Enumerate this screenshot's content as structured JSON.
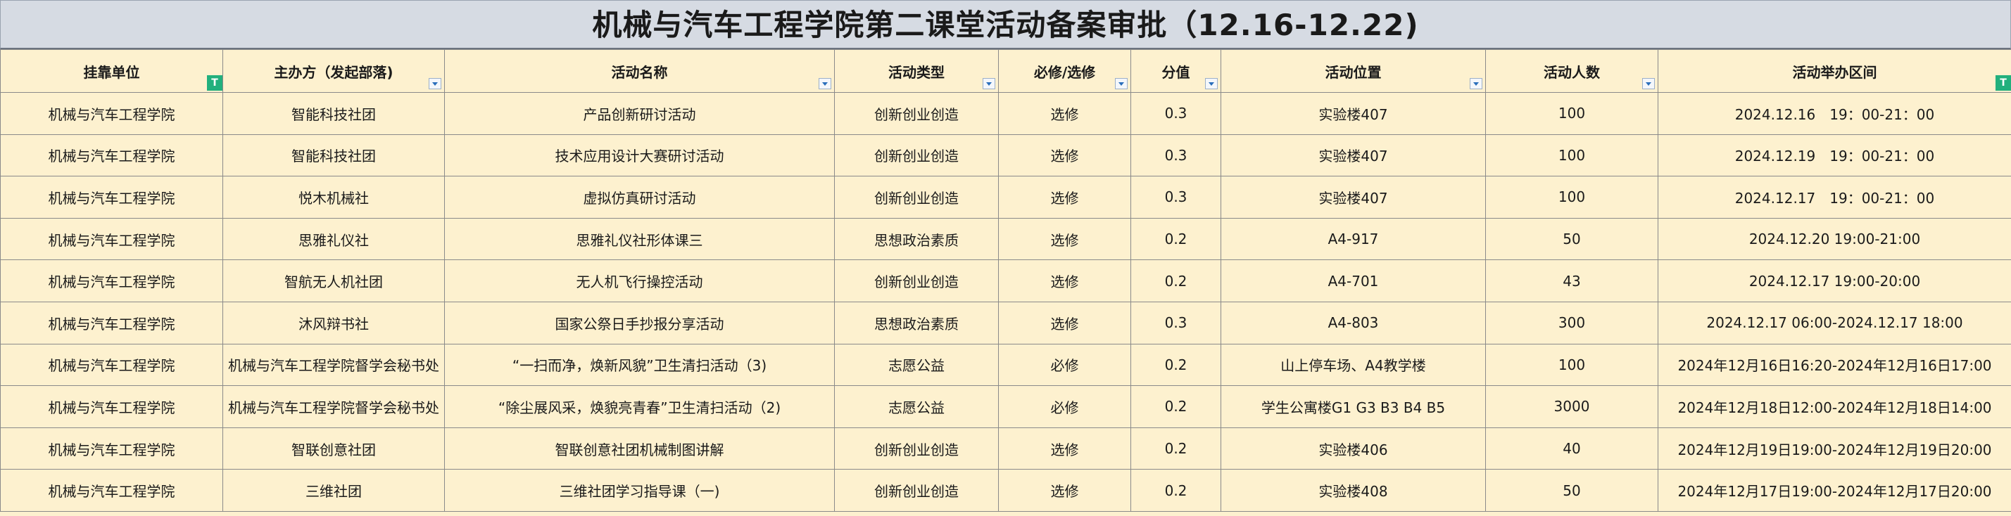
{
  "title": "机械与汽车工程学院第二课堂活动备案审批（12.16-12.22)",
  "headers": [
    "挂靠单位",
    "主办方（发起部落)",
    "活动名称",
    "活动类型",
    "必修/选修",
    "分值",
    "活动位置",
    "活动人数",
    "活动举办区间"
  ],
  "rows": [
    [
      "机械与汽车工程学院",
      "智能科技社团",
      "产品创新研讨活动",
      "创新创业创造",
      "选修",
      "0.3",
      "实验楼407",
      "100",
      "2024.12.16　19：00-21：00"
    ],
    [
      "机械与汽车工程学院",
      "智能科技社团",
      "技术应用设计大赛研讨活动",
      "创新创业创造",
      "选修",
      "0.3",
      "实验楼407",
      "100",
      "2024.12.19　19：00-21：00"
    ],
    [
      "机械与汽车工程学院",
      "悦木机械社",
      "虚拟仿真研讨活动",
      "创新创业创造",
      "选修",
      "0.3",
      "实验楼407",
      "100",
      "2024.12.17　19：00-21：00"
    ],
    [
      "机械与汽车工程学院",
      "思雅礼仪社",
      "思雅礼仪社形体课三",
      "思想政治素质",
      "选修",
      "0.2",
      "A4-917",
      "50",
      "2024.12.20 19:00-21:00"
    ],
    [
      "机械与汽车工程学院",
      "智航无人机社团",
      "无人机飞行操控活动",
      "创新创业创造",
      "选修",
      "0.2",
      "A4-701",
      "43",
      "2024.12.17 19:00-20:00"
    ],
    [
      "机械与汽车工程学院",
      "沐风辩书社",
      "国家公祭日手抄报分享活动",
      "思想政治素质",
      "选修",
      "0.3",
      "A4-803",
      "300",
      "2024.12.17 06:00-2024.12.17 18:00"
    ],
    [
      "机械与汽车工程学院",
      "机械与汽车工程学院督学会秘书处",
      "“一扫而净，焕新风貌”卫生清扫活动（3)",
      "志愿公益",
      "必修",
      "0.2",
      "山上停车场、A4教学楼",
      "100",
      "2024年12月16日16:20-2024年12月16日17:00"
    ],
    [
      "机械与汽车工程学院",
      "机械与汽车工程学院督学会秘书处",
      "“除尘展风采，焕貌亮青春”卫生清扫活动（2)",
      "志愿公益",
      "必修",
      "0.2",
      "学生公寓楼G1 G3 B3 B4 B5",
      "3000",
      "2024年12月18日12:00-2024年12月18日14:00"
    ],
    [
      "机械与汽车工程学院",
      "智联创意社团",
      "智联创意社团机械制图讲解",
      "创新创业创造",
      "选修",
      "0.2",
      "实验楼406",
      "40",
      "2024年12月19日19:00-2024年12月19日20:00"
    ],
    [
      "机械与汽车工程学院",
      "三维社团",
      "三维社团学习指导课（一)",
      "创新创业创造",
      "选修",
      "0.2",
      "实验楼408",
      "50",
      "2024年12月17日19:00-2024年12月17日20:00"
    ]
  ],
  "filter_badge": "T"
}
